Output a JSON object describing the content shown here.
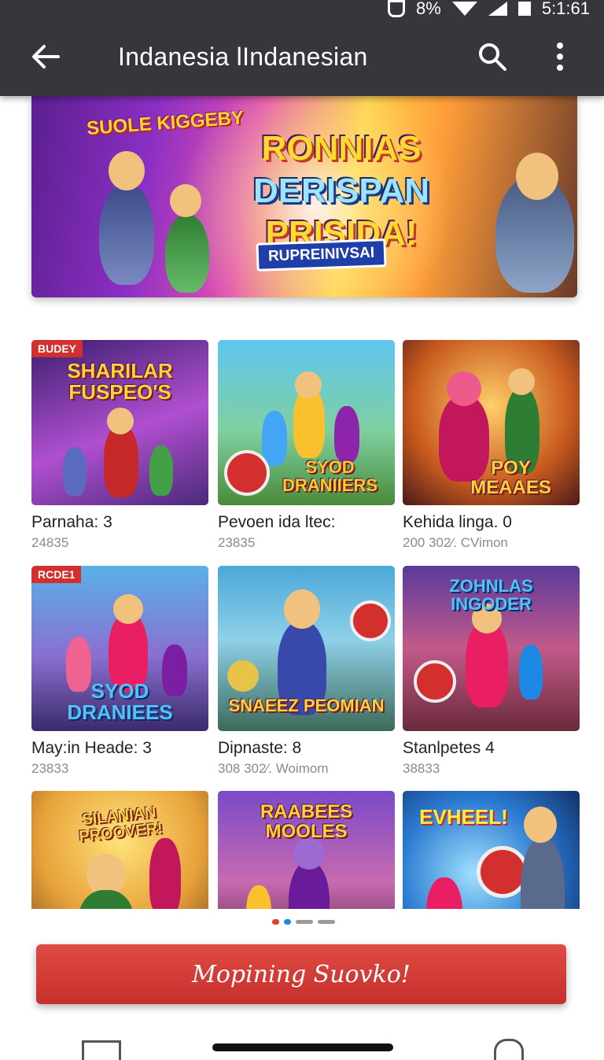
{
  "status": {
    "battery_pct": "8%",
    "time": "5:1:61"
  },
  "appbar": {
    "title": "Indanesia lIndanesian"
  },
  "hero": {
    "logo": "SUOLE KIGGEBY",
    "headline": [
      "RONNIAS",
      "DERISPAN",
      "PRISIDA!"
    ],
    "tag": "RUPREINIVSAI"
  },
  "games": [
    {
      "name": "Parnaha: 3",
      "sub": "24835",
      "badge": "BUDEY",
      "art": "SHARILAR FUSPEO'S"
    },
    {
      "name": "Pevoen ida ltec:",
      "sub": "23835",
      "badge": "",
      "art": "SYOD DRANIIERS"
    },
    {
      "name": "Kehida linga. 0",
      "sub": "200 302⁄. CVimon",
      "badge": "",
      "art": "POY MEAAES"
    },
    {
      "name": "May:in Heade: 3",
      "sub": "23833",
      "badge": "RCDE1",
      "art": "SYOD DRANIEES"
    },
    {
      "name": "Dipnaste: 8",
      "sub": "308 302⁄. Woimom",
      "badge": "",
      "art": "SNAEEZ PEOMIAN"
    },
    {
      "name": "Stanlpetes 4",
      "sub": "38833",
      "badge": "",
      "art": "ZOHNLAS INGODER"
    },
    {
      "name": "",
      "sub": "",
      "badge": "",
      "art": "SILANIAN PROOVER!"
    },
    {
      "name": "",
      "sub": "",
      "badge": "",
      "art": "RAABEES MOOLES"
    },
    {
      "name": "",
      "sub": "",
      "badge": "",
      "art": "EVHEEL!"
    }
  ],
  "cta": {
    "label": "Mopining Suovko!"
  },
  "colors": {
    "appbar": "#36373d",
    "cta": "#d33a35",
    "accent_blue": "#1e88e5"
  },
  "icons": [
    "back-arrow-icon",
    "search-icon",
    "more-vert-icon"
  ]
}
